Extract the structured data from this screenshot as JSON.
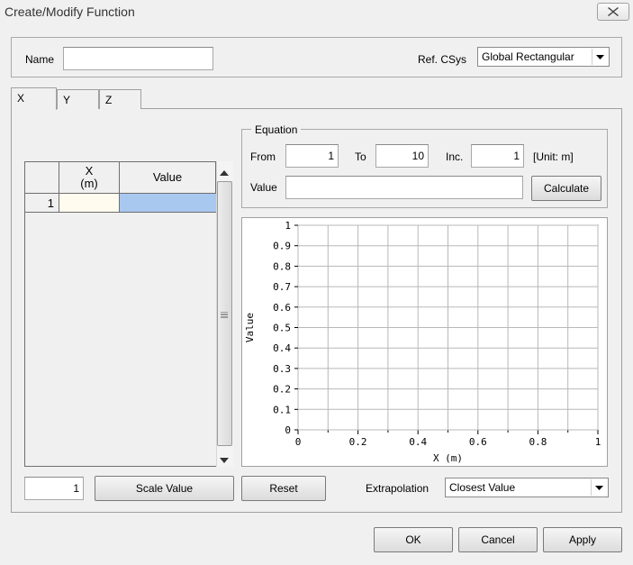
{
  "window": {
    "title": "Create/Modify Function"
  },
  "name_field": {
    "label": "Name",
    "value": ""
  },
  "ref_csys": {
    "label": "Ref. CSys",
    "selected": "Global Rectangular"
  },
  "tabs": [
    {
      "label": "X"
    },
    {
      "label": "Y"
    },
    {
      "label": "Z"
    }
  ],
  "table": {
    "col_x_line1": "X",
    "col_x_line2": "(m)",
    "col_value": "Value",
    "rows": [
      {
        "index": "1",
        "x": "",
        "value": ""
      }
    ]
  },
  "equation": {
    "legend": "Equation",
    "from_label": "From",
    "from_value": "1",
    "to_label": "To",
    "to_value": "10",
    "inc_label": "Inc.",
    "inc_value": "1",
    "unit": "[Unit: m]",
    "value_label": "Value",
    "value_value": "",
    "calculate_label": "Calculate"
  },
  "chart_data": {
    "type": "line",
    "x": [],
    "series": [],
    "xlabel": "X (m)",
    "ylabel": "Value",
    "xlim": [
      0,
      1
    ],
    "ylim": [
      0,
      1
    ],
    "x_ticks": [
      "0",
      "0.2",
      "0.4",
      "0.6",
      "0.8",
      "1"
    ],
    "y_ticks": [
      "0",
      "0.1",
      "0.2",
      "0.3",
      "0.4",
      "0.5",
      "0.6",
      "0.7",
      "0.8",
      "0.9",
      "1"
    ],
    "grid": true
  },
  "bottom_controls": {
    "scale_input": "1",
    "scale_value_label": "Scale Value",
    "reset_label": "Reset",
    "extrapolation_label": "Extrapolation",
    "extrapolation_selected": "Closest Value"
  },
  "dialog_buttons": {
    "ok": "OK",
    "cancel": "Cancel",
    "apply": "Apply"
  }
}
